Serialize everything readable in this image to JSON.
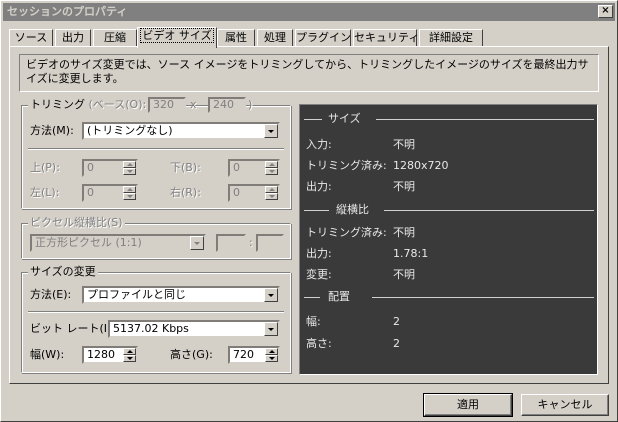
{
  "window": {
    "title": "セッションのプロパティ",
    "close": "×"
  },
  "tabs": [
    "ソース",
    "出力",
    "圧縮",
    "ビデオ サイズ",
    "属性",
    "処理",
    "プラグイン",
    "セキュリティ",
    "詳細設定"
  ],
  "description": "ビデオのサイズ変更では、ソース イメージをトリミングしてから、トリミングしたイメージのサイズを最終出力サイズに変更します。",
  "cropping": {
    "legend": "トリミング",
    "base_label": "(ベース(O):",
    "base_width": "320",
    "x_sep": "x",
    "base_height": "240",
    "close_paren": ")",
    "method_label": "方法(M):",
    "method_value": "(トリミングなし)",
    "top_label": "上(P):",
    "top_value": "0",
    "bottom_label": "下(B):",
    "bottom_value": "0",
    "left_label": "左(L):",
    "left_value": "0",
    "right_label": "右(R):",
    "right_value": "0"
  },
  "pixel_aspect": {
    "legend": "ピクセル縦横比(S)",
    "value": "正方形ピクセル (1:1)",
    "colon": ":"
  },
  "resize": {
    "legend": "サイズの変更",
    "method_label": "方法(E):",
    "method_value": "プロファイルと同じ",
    "bitrate_label": "ビット レート(I):",
    "bitrate_value": "5137.02 Kbps",
    "width_label": "幅(W):",
    "width_value": "1280",
    "height_label": "高さ(G):",
    "height_value": "720"
  },
  "info": {
    "size_header": "サイズ",
    "input_label": "入力:",
    "input_value": "不明",
    "cropped_label": "トリミング済み:",
    "cropped_value": "1280x720",
    "output_label": "出力:",
    "output_value": "不明",
    "aspect_header": "縦横比",
    "aspect_cropped_label": "トリミング済み:",
    "aspect_cropped_value": "不明",
    "aspect_output_label": "出力:",
    "aspect_output_value": "1.78:1",
    "aspect_change_label": "変更:",
    "aspect_change_value": "不明",
    "placement_header": "配置",
    "place_width_label": "幅:",
    "place_width_value": "2",
    "place_height_label": "高さ:",
    "place_height_value": "2"
  },
  "buttons": {
    "apply": "適用",
    "cancel": "キャンセル"
  },
  "colors": {
    "face": "#d4d0c8",
    "info_bg": "#3a3a3a",
    "title_inactive": "#808080"
  }
}
